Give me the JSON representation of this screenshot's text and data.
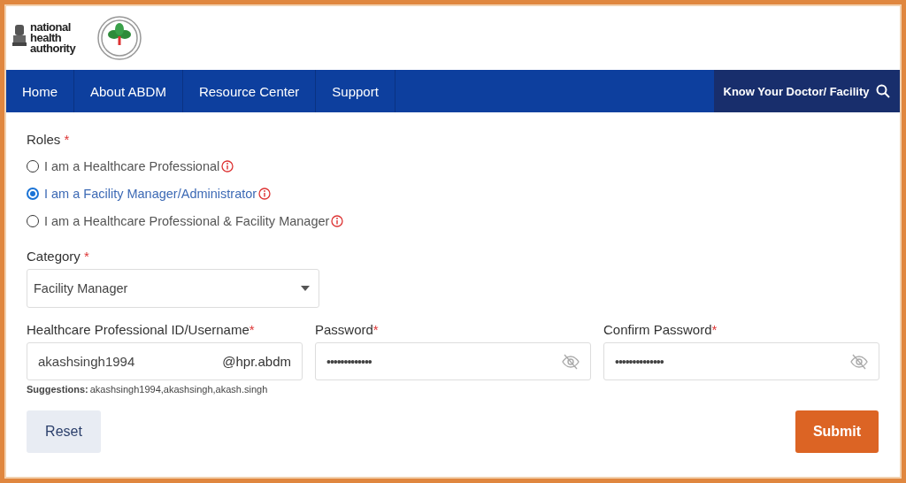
{
  "header": {
    "logo_lines": [
      "national",
      "health",
      "authority"
    ]
  },
  "nav": {
    "items": [
      {
        "label": "Home"
      },
      {
        "label": "About ABDM"
      },
      {
        "label": "Resource Center"
      },
      {
        "label": "Support"
      }
    ],
    "search_link": "Know Your Doctor/ Facility"
  },
  "roles": {
    "label": "Roles",
    "required_mark": "*",
    "options": [
      {
        "label": "I am a Healthcare Professional",
        "selected": false
      },
      {
        "label": "I am a Facility Manager/Administrator",
        "selected": true
      },
      {
        "label": "I am a Healthcare Professional & Facility Manager",
        "selected": false
      }
    ]
  },
  "category": {
    "label": "Category",
    "required_mark": "*",
    "value": "Facility Manager"
  },
  "username": {
    "label": "Healthcare Professional ID/Username",
    "required_mark": "*",
    "value": "akashsingh1994",
    "suffix": "@hpr.abdm",
    "suggestions_label": "Suggestions:",
    "suggestions": "akashsingh1994,akashsingh,akash.singh"
  },
  "password": {
    "label": "Password",
    "required_mark": "*",
    "value": "•••••••••••••"
  },
  "confirm_password": {
    "label": "Confirm Password",
    "required_mark": "*",
    "value": "••••••••••••••"
  },
  "buttons": {
    "reset": "Reset",
    "submit": "Submit"
  }
}
